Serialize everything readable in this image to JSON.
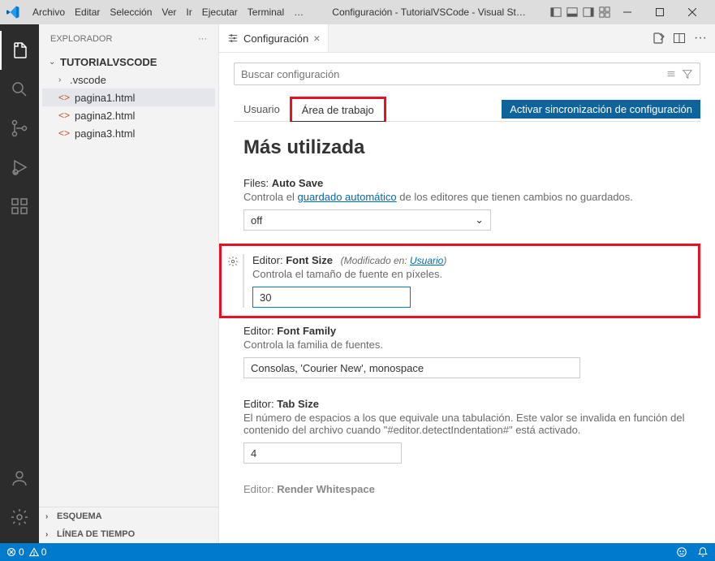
{
  "titlebar": {
    "menus": [
      "Archivo",
      "Editar",
      "Selección",
      "Ver",
      "Ir",
      "Ejecutar",
      "Terminal",
      "…"
    ],
    "title": "Configuración - TutorialVSCode - Visual St…"
  },
  "sidebar": {
    "header": "EXPLORADOR",
    "root": "TUTORIALVSCODE",
    "items": [
      {
        "label": ".vscode",
        "type": "folder"
      },
      {
        "label": "pagina1.html",
        "type": "file",
        "selected": true
      },
      {
        "label": "pagina2.html",
        "type": "file"
      },
      {
        "label": "pagina3.html",
        "type": "file"
      }
    ],
    "sections": [
      "ESQUEMA",
      "LÍNEA DE TIEMPO"
    ]
  },
  "tab": {
    "label": "Configuración"
  },
  "settings": {
    "searchPlaceholder": "Buscar configuración",
    "tabs": {
      "user": "Usuario",
      "workspace": "Área de trabajo"
    },
    "syncButton": "Activar sincronización de configuración",
    "sectionTitle": "Más utilizada",
    "autoSave": {
      "label_prefix": "Files:",
      "label_name": "Auto Save",
      "desc_before": "Controla el ",
      "desc_link": "guardado automático",
      "desc_after": " de los editores que tienen cambios no guardados.",
      "value": "off"
    },
    "fontSize": {
      "label_prefix": "Editor:",
      "label_name": "Font Size",
      "modified_before": "(Modificado en: ",
      "modified_link": "Usuario",
      "modified_after": ")",
      "desc": "Controla el tamaño de fuente en píxeles.",
      "value": "30"
    },
    "fontFamily": {
      "label_prefix": "Editor:",
      "label_name": "Font Family",
      "desc": "Controla la familia de fuentes.",
      "value": "Consolas, 'Courier New', monospace"
    },
    "tabSize": {
      "label_prefix": "Editor:",
      "label_name": "Tab Size",
      "desc": "El número de espacios a los que equivale una tabulación. Este valor se invalida en función del contenido del archivo cuando \"#editor.detectIndentation#\" está activado.",
      "value": "4"
    },
    "renderWhitespace": {
      "label_prefix": "Editor:",
      "label_name": "Render Whitespace"
    }
  },
  "statusbar": {
    "errors": "0",
    "warnings": "0"
  }
}
